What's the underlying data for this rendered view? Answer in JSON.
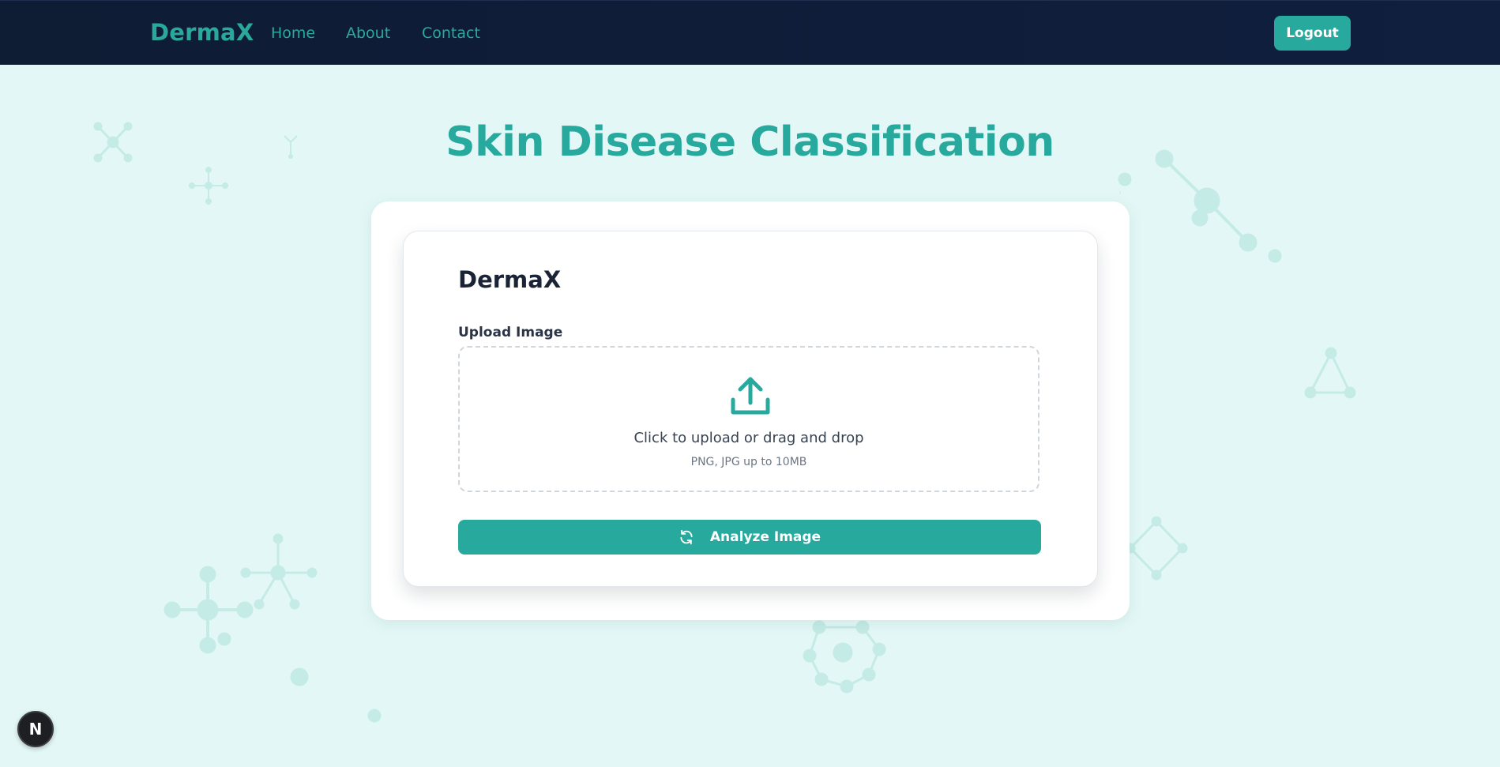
{
  "navbar": {
    "brand": "DermaX",
    "links": [
      "Home",
      "About",
      "Contact"
    ],
    "logout_label": "Logout",
    "background_color": "#0f1d3a",
    "accent_color": "#27a99e"
  },
  "main": {
    "title": "Skin Disease Classification",
    "card": {
      "title": "DermaX",
      "upload_label": "Upload Image",
      "dropzone": {
        "icon": "upload-icon",
        "text": "Click to upload or drag and drop",
        "hint": "PNG, JPG up to 10MB"
      },
      "analyze_button": {
        "icon": "refresh-icon",
        "label": "Analyze Image"
      }
    }
  },
  "badge": {
    "letter": "N"
  },
  "colors": {
    "page_background": "#e3f8f6",
    "primary": "#27a99e",
    "card_background": "#ffffff"
  }
}
